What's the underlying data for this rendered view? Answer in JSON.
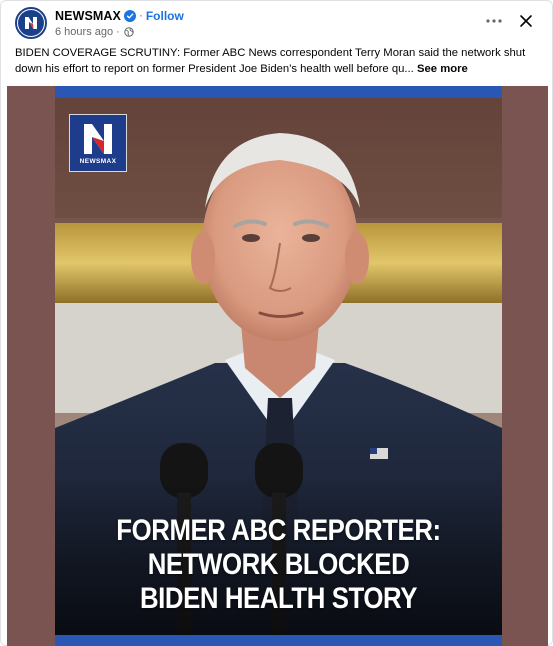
{
  "post": {
    "page_name": "NEWSMAX",
    "follow_label": "Follow",
    "dot": "·",
    "timestamp": "6 hours ago",
    "meta_dot": "·",
    "caption": "BIDEN COVERAGE SCRUTINY: Former ABC News correspondent Terry Moran said the network shut down his effort to report on former President Joe Biden's health well before qu...",
    "see_more": "See more"
  },
  "icons": {
    "avatar": "newsmax-logo-icon",
    "verified": "verified-badge-icon",
    "audience": "globe-icon",
    "more": "more-options-icon",
    "close": "close-icon"
  },
  "image": {
    "badge_text": "NEWSMAX",
    "headline_lines": [
      "FORMER ABC REPORTER:",
      "NETWORK BLOCKED",
      "BIDEN HEALTH STORY"
    ]
  },
  "colors": {
    "brand_blue": "#1e3c8c",
    "link_blue": "#1b74e4",
    "frame_bg": "#7a5450",
    "bar_blue": "#2a57b3"
  }
}
